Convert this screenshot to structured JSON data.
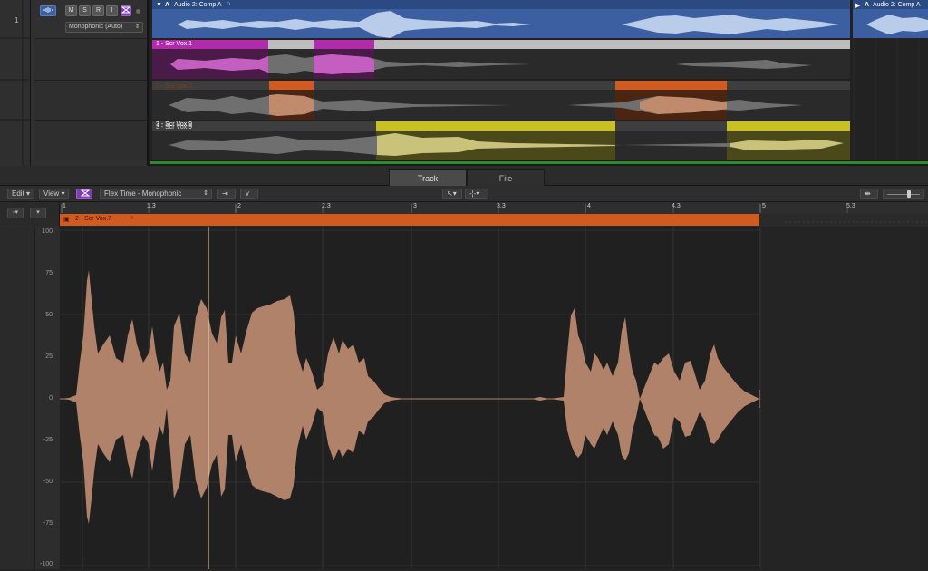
{
  "track": {
    "number": "1",
    "buttons": [
      "M",
      "S",
      "R",
      "I"
    ],
    "mode_select": "Monophonic (Auto)"
  },
  "arrange": {
    "comp_region_label": "Audio 2: Comp A",
    "comp_region_label_right": "Audio 2: Comp A",
    "takes": [
      {
        "label": "1 - Scr Vox.1",
        "color": "#b02cab"
      },
      {
        "label": "2 - Scr Vox.7",
        "color": "#d05a1f"
      },
      {
        "label": "3 - Scr Vox.9",
        "color": "#c9c023"
      }
    ]
  },
  "lower": {
    "tabs": [
      {
        "label": "Track",
        "active": true
      },
      {
        "label": "File",
        "active": false
      }
    ],
    "toolbar": {
      "edit_menu": "Edit",
      "view_menu": "View",
      "flex_mode": "Flex Time - Monophonic"
    },
    "ruler_labels": [
      "1",
      "1.3",
      "2",
      "2.3",
      "3",
      "3.3",
      "4",
      "4.3",
      "5",
      "5.3"
    ],
    "region_label": "2 - Scr Vox.7",
    "y_axis": [
      "100",
      "75",
      "50",
      "25",
      "0",
      "-25",
      "-50",
      "-75",
      "-100"
    ]
  },
  "colors": {
    "comp_blue": "#3b5fa0",
    "take1": "#b02cab",
    "take2": "#d05a1f",
    "take3": "#c9c023",
    "waveform_main": "#b1826a"
  }
}
